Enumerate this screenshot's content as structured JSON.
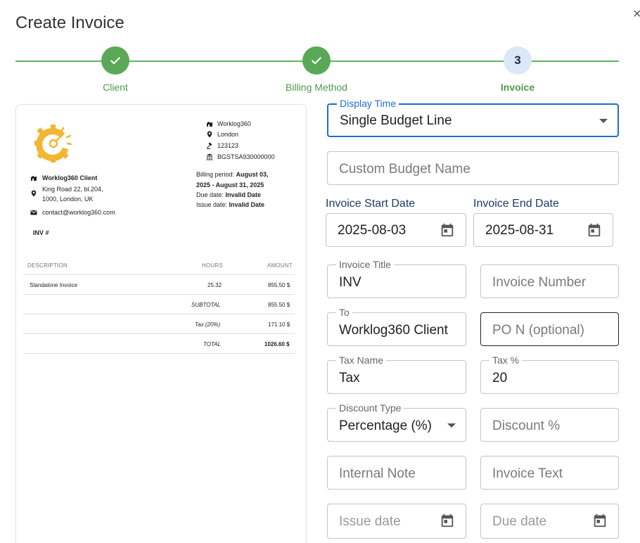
{
  "dialog": {
    "title": "Create Invoice",
    "close_glyph": "×"
  },
  "stepper": {
    "steps": [
      {
        "label": "Client",
        "status": "done"
      },
      {
        "label": "Billing Method",
        "status": "done"
      },
      {
        "label": "Invoice",
        "status": "current",
        "number": "3"
      }
    ],
    "line_color": "#5cb85c"
  },
  "preview": {
    "company": {
      "name": "Worklog360",
      "city": "London",
      "registration": "123123",
      "iban": "BGSTSA930000000"
    },
    "client": {
      "name": "Worklog360 Client",
      "address_line1": "King Road 22, bl.204,",
      "address_line2": "1000, London, UK",
      "email": "contact@worklog360.com"
    },
    "billing": {
      "period_label": "Billing period:",
      "period_value_1": "August 03,",
      "period_value_2": "2025 - August 31, 2025",
      "due_label": "Due date:",
      "due_value": "Invalid Date",
      "issue_label": "Issue date:",
      "issue_value": "Invalid Date"
    },
    "invoice_ref": "INV #",
    "table": {
      "headers": {
        "description": "DESCRIPTION",
        "hours": "HOURS",
        "amount": "AMOUNT"
      },
      "rows": [
        {
          "description": "Standalone Invoice",
          "hours": "25.32",
          "amount": "855.50 $"
        }
      ],
      "subtotal_label": "SUBTOTAL",
      "subtotal_value": "855.50 $",
      "tax_label": "Tax (20%)",
      "tax_value": "171.10 $",
      "total_label": "TOTAL",
      "total_value": "1026.60 $"
    }
  },
  "form": {
    "display_time": {
      "label": "Display Time",
      "value": "Single Budget Line"
    },
    "custom_budget_name": {
      "placeholder": "Custom Budget Name"
    },
    "invoice_start_date": {
      "label": "Invoice Start Date",
      "value": "2025-08-03"
    },
    "invoice_end_date": {
      "label": "Invoice End Date",
      "value": "2025-08-31"
    },
    "invoice_title": {
      "label": "Invoice Title",
      "value": "INV"
    },
    "invoice_number": {
      "placeholder": "Invoice Number"
    },
    "to": {
      "label": "To",
      "value": "Worklog360 Client"
    },
    "po_number": {
      "placeholder": "PO N (optional)"
    },
    "tax_name": {
      "label": "Tax Name",
      "value": "Tax"
    },
    "tax_percent": {
      "label": "Tax %",
      "value": "20"
    },
    "discount_type": {
      "label": "Discount Type",
      "value": "Percentage (%)"
    },
    "discount_percent": {
      "placeholder": "Discount %"
    },
    "internal_note": {
      "placeholder": "Internal Note"
    },
    "invoice_text": {
      "placeholder": "Invoice Text"
    },
    "issue_date": {
      "placeholder": "Issue date"
    },
    "due_date": {
      "placeholder": "Due date"
    }
  },
  "colors": {
    "accent": "#1d6fcf",
    "step_done": "#5aa857",
    "step_current_bg": "#dbe8f7",
    "logo_gear": "#f2b632"
  }
}
